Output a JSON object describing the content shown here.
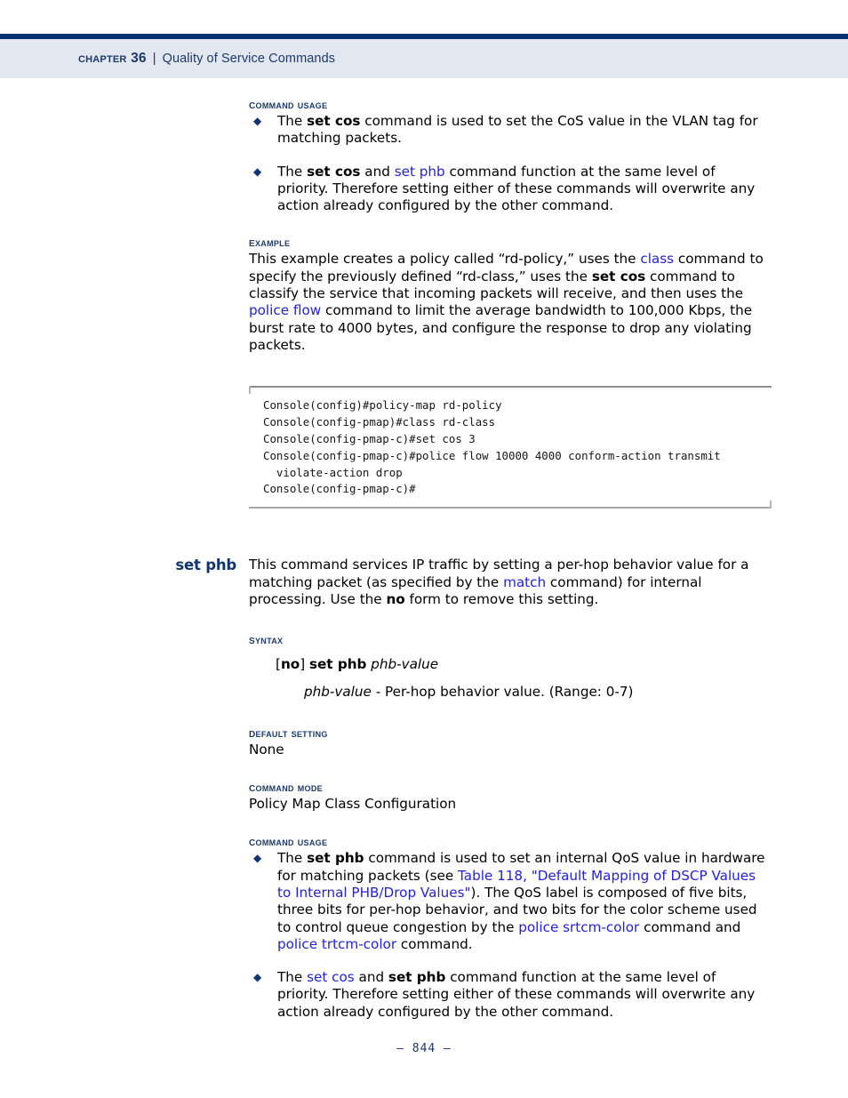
{
  "header": {
    "chapter": "Chapter 36",
    "separator": "|",
    "section_title": "Quality of Service Commands"
  },
  "footer": {
    "page_number": "–  844  –"
  },
  "colors": {
    "header_rule": "#003070",
    "header_band": "#e3e7f0",
    "heading_navy": "#1b3a6b",
    "command_title_navy": "#12356e",
    "link_blue": "#2222dd",
    "body_text": "#000000"
  },
  "set_cos_section": {
    "command_usage_heading": "Command Usage",
    "bullets": [
      {
        "parts": [
          {
            "t": "The ",
            "s": "normal"
          },
          {
            "t": "set cos",
            "s": "bold"
          },
          {
            "t": " command is used to set the CoS value in the VLAN tag for matching packets.",
            "s": "normal"
          }
        ]
      },
      {
        "parts": [
          {
            "t": "The ",
            "s": "normal"
          },
          {
            "t": "set cos",
            "s": "bold"
          },
          {
            "t": " and ",
            "s": "normal"
          },
          {
            "t": "set phb",
            "s": "link"
          },
          {
            "t": " command function at the same level of priority. Therefore setting either of these commands will overwrite any action already configured by the other command.",
            "s": "normal"
          }
        ]
      }
    ],
    "example_heading": "Example",
    "example_parts": [
      {
        "t": "This example creates a policy called “rd-policy,” uses the ",
        "s": "normal"
      },
      {
        "t": "class",
        "s": "link"
      },
      {
        "t": " command to specify the previously defined “rd-class,” uses the ",
        "s": "normal"
      },
      {
        "t": "set cos",
        "s": "bold"
      },
      {
        "t": " command to classify the service that incoming packets will receive, and then uses the ",
        "s": "normal"
      },
      {
        "t": "police flow",
        "s": "link"
      },
      {
        "t": " command to limit the average bandwidth to 100,000 Kbps, the burst rate to 4000 bytes, and configure the response to drop any violating packets.",
        "s": "normal"
      }
    ],
    "console_lines": [
      "Console(config)#policy-map rd-policy",
      "Console(config-pmap)#class rd-class",
      "Console(config-pmap-c)#set cos 3",
      "Console(config-pmap-c)#police flow 10000 4000 conform-action transmit",
      "  violate-action drop",
      "Console(config-pmap-c)#"
    ]
  },
  "set_phb_section": {
    "command_name": "set phb",
    "description_parts": [
      {
        "t": "This command services IP traffic by setting a per-hop behavior value for a matching packet (as specified by the ",
        "s": "normal"
      },
      {
        "t": "match",
        "s": "link"
      },
      {
        "t": " command) for internal processing. Use the ",
        "s": "normal"
      },
      {
        "t": "no",
        "s": "bold"
      },
      {
        "t": " form to remove this setting.",
        "s": "normal"
      }
    ],
    "syntax_heading": "Syntax",
    "syntax_parts": [
      {
        "t": "[",
        "s": "normal"
      },
      {
        "t": "no",
        "s": "bold"
      },
      {
        "t": "] ",
        "s": "normal"
      },
      {
        "t": "set phb",
        "s": "bold"
      },
      {
        "t": " ",
        "s": "normal"
      },
      {
        "t": "phb-value",
        "s": "italic"
      }
    ],
    "syntax_param_parts": [
      {
        "t": "phb-value",
        "s": "italic"
      },
      {
        "t": " - Per-hop behavior value. (Range: 0-7)",
        "s": "normal"
      }
    ],
    "default_setting_heading": "Default Setting",
    "default_setting_value": "None",
    "command_mode_heading": "Command Mode",
    "command_mode_value": "Policy Map Class Configuration",
    "command_usage_heading": "Command Usage",
    "bullets": [
      {
        "parts": [
          {
            "t": "The ",
            "s": "normal"
          },
          {
            "t": "set phb",
            "s": "bold"
          },
          {
            "t": " command is used to set an internal QoS value in hardware for matching packets (see ",
            "s": "normal"
          },
          {
            "t": "Table 118, \"Default Mapping of DSCP Values to Internal PHB/Drop Values\"",
            "s": "link"
          },
          {
            "t": "). The QoS label is composed of five bits, three bits for per-hop behavior, and two bits for the color scheme used to control queue congestion by the ",
            "s": "normal"
          },
          {
            "t": "police srtcm-color",
            "s": "link"
          },
          {
            "t": " command and ",
            "s": "normal"
          },
          {
            "t": "police trtcm-color",
            "s": "link"
          },
          {
            "t": " command.",
            "s": "normal"
          }
        ]
      },
      {
        "parts": [
          {
            "t": "The ",
            "s": "normal"
          },
          {
            "t": "set cos",
            "s": "link"
          },
          {
            "t": " and ",
            "s": "normal"
          },
          {
            "t": "set phb",
            "s": "bold"
          },
          {
            "t": " command function at the same level of priority. Therefore setting either of these commands will overwrite any action already configured by the other command.",
            "s": "normal"
          }
        ]
      }
    ]
  }
}
